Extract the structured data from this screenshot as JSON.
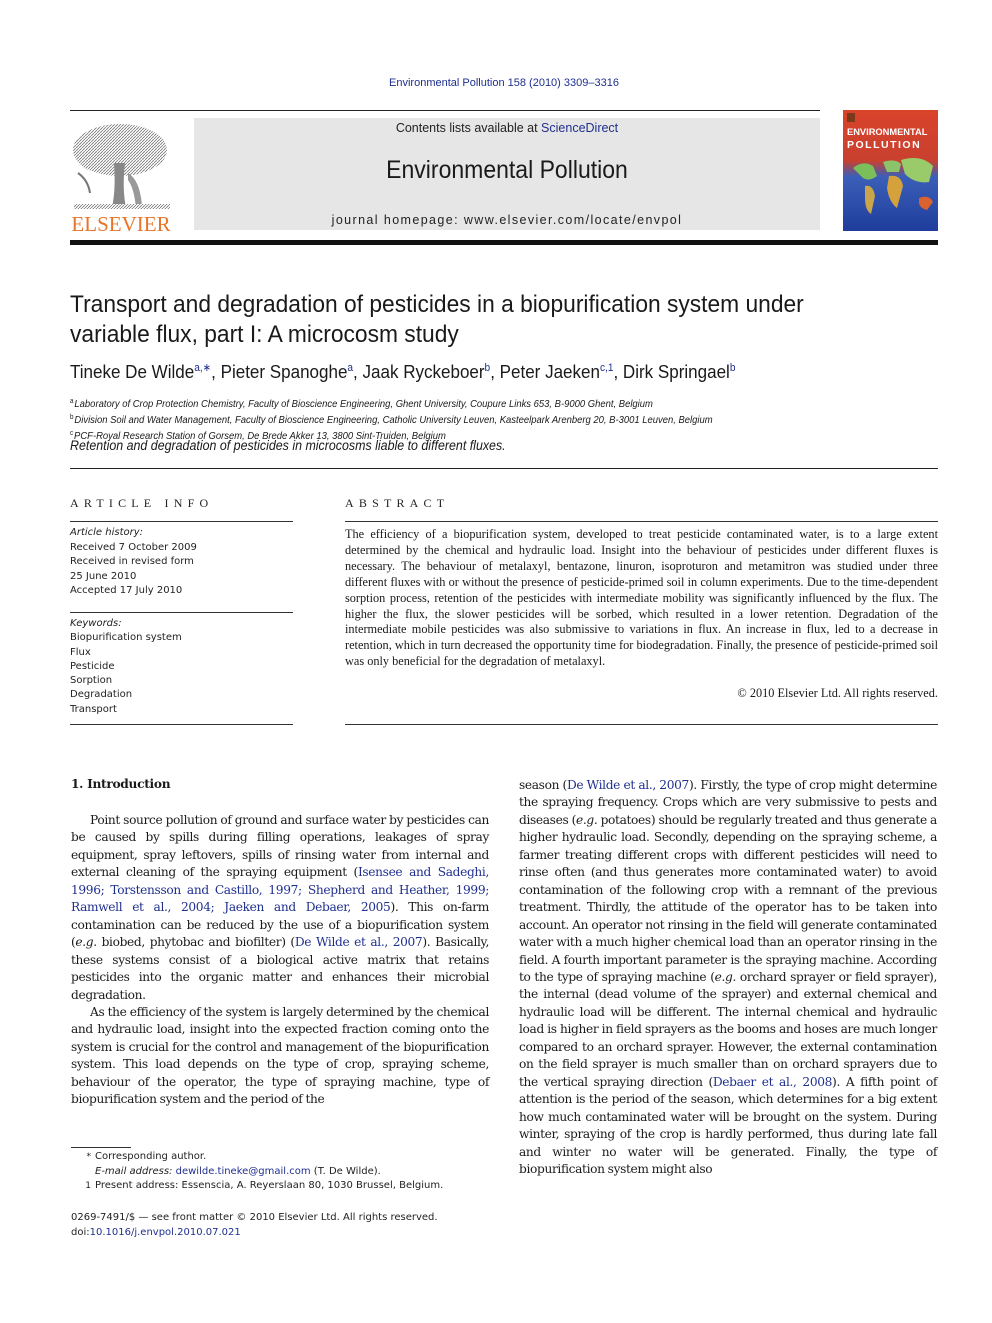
{
  "header": {
    "journal_ref": "Environmental Pollution 158 (2010) 3309–3316",
    "contents_prefix": "Contents lists available at ",
    "contents_link": "ScienceDirect",
    "journal_title": "Environmental Pollution",
    "homepage": "journal homepage: www.elsevier.com/locate/envpol",
    "publisher_logo": "ELSEVIER",
    "cover_title_1": "ENVIRONMENTAL",
    "cover_title_2": "POLLUTION",
    "colors": {
      "link": "#1f2f8f",
      "elsevier_orange": "#e8742a",
      "header_gray": "#e6e6e6"
    }
  },
  "article": {
    "title_line_1": "Transport and degradation of pesticides in a biopurification system under",
    "title_line_2": "variable flux, part I: A microcosm study",
    "authors": [
      {
        "name": "Tineke De Wilde",
        "sup": "a,∗",
        "sep": ", "
      },
      {
        "name": "Pieter Spanoghe",
        "sup": "a",
        "sep": ", "
      },
      {
        "name": "Jaak Ryckeboer",
        "sup": "b",
        "sep": ", "
      },
      {
        "name": "Peter Jaeken",
        "sup": "c,1",
        "sep": ", "
      },
      {
        "name": "Dirk Springael",
        "sup": "b",
        "sep": ""
      }
    ],
    "affiliations": [
      {
        "mark": "a",
        "text": "Laboratory of Crop Protection Chemistry, Faculty of Bioscience Engineering, Ghent University, Coupure Links 653, B-9000 Ghent, Belgium"
      },
      {
        "mark": "b",
        "text": "Division Soil and Water Management, Faculty of Bioscience Engineering, Catholic University Leuven, Kasteelpark Arenberg 20, B-3001 Leuven, Belgium"
      },
      {
        "mark": "c",
        "text": "PCF-Royal Research Station of Gorsem, De Brede Akker 13, 3800 Sint-Truiden, Belgium"
      }
    ],
    "highlight": "Retention and degradation of pesticides in microcosms liable to different fluxes."
  },
  "article_info": {
    "heading": "ARTICLE INFO",
    "history_label": "Article history:",
    "history": [
      "Received 7 October 2009",
      "Received in revised form",
      "25 June 2010",
      "Accepted 17 July 2010"
    ],
    "keywords_label": "Keywords:",
    "keywords": [
      "Biopurification system",
      "Flux",
      "Pesticide",
      "Sorption",
      "Degradation",
      "Transport"
    ]
  },
  "abstract": {
    "heading": "ABSTRACT",
    "text": "The efficiency of a biopurification system, developed to treat pesticide contaminated water, is to a large extent determined by the chemical and hydraulic load. Insight into the behaviour of pesticides under different fluxes is necessary. The behaviour of metalaxyl, bentazone, linuron, isoproturon and metamitron was studied under three different fluxes with or without the presence of pesticide-primed soil in column experiments. Due to the time-dependent sorption process, retention of the pesticides with intermediate mobility was significantly influenced by the flux. The higher the flux, the slower pesticides will be sorbed, which resulted in a lower retention. Degradation of the intermediate mobile pesticides was also submissive to variations in flux. An increase in flux, led to a decrease in retention, which in turn decreased the opportunity time for biodegradation. Finally, the presence of pesticide-primed soil was only beneficial for the degradation of metalaxyl.",
    "copyright": "© 2010 Elsevier Ltd. All rights reserved."
  },
  "body": {
    "section_heading": "1.  Introduction",
    "p1": {
      "t1": "Point source pollution of ground and surface water by pesticides can be caused by spills during filling operations, leakages of spray equipment, spray leftovers, spills of rinsing water from internal and external cleaning of the spraying equipment (",
      "c1": "Isensee and Sadeghi, 1996; Torstensson and Castillo, 1997; Shepherd and Heather, 1999; Ramwell et al., 2004; Jaeken and Debaer, 2005",
      "t2": "). This on-farm contamination can be reduced by the use of a biopurification system (",
      "eg": "e.g.",
      "t3": " biobed, phytobac and biofilter) (",
      "c2": "De Wilde et al., 2007",
      "t4": "). Basically, these systems consist of a biological active matrix that retains pesticides into the organic matter and enhances their microbial degradation."
    },
    "p2": {
      "t1": "As the efficiency of the system is largely determined by the chemical and hydraulic load, insight into the expected fraction coming onto the system is crucial for the control and management of the biopurification system. This load depends on the type of crop, spraying scheme, behaviour of the operator, the type of spraying machine, type of biopurification system and the period of the"
    },
    "right": {
      "t1": "season (",
      "c1": "De Wilde et al., 2007",
      "t2": "). Firstly, the type of crop might determine the spraying frequency. Crops which are very submissive to pests and diseases (",
      "eg1": "e.g.",
      "t3": " potatoes) should be regularly treated and thus generate a higher hydraulic load. Secondly, depending on the spraying scheme, a farmer treating different crops with different pesticides will need to rinse often (and thus generates more contaminated water) to avoid contamination of the following crop with a remnant of the previous treatment. Thirdly, the attitude of the operator has to be taken into account. An operator not rinsing in the field will generate contaminated water with a much higher chemical load than an operator rinsing in the field. A fourth important parameter is the spraying machine. According to the type of spraying machine (",
      "eg2": "e.g.",
      "t4": " orchard sprayer or field sprayer), the internal (dead volume of the sprayer) and external chemical and hydraulic load will be different. The internal chemical and hydraulic load is higher in field sprayers as the booms and hoses are much longer compared to an orchard sprayer. However, the external contamination on the field sprayer is much smaller than on orchard sprayers due to the vertical spraying direction (",
      "c2": "Debaer et al., 2008",
      "t5": "). A fifth point of attention is the period of the season, which determines for a big extent how much contaminated water will be brought on the system. During winter, spraying of the crop is hardly performed, thus during late fall and winter no water will be generated. Finally, the type of biopurification system might also"
    }
  },
  "footnotes": {
    "star_mark": "*",
    "star_text": "Corresponding author.",
    "email_label": "E-mail address:",
    "email": "dewilde.tineke@gmail.com",
    "email_suffix": " (T. De Wilde).",
    "one_mark": "1",
    "one_text": "Present address: Essenscia, A. Reyerslaan 80, 1030 Brussel, Belgium."
  },
  "footer": {
    "issn": "0269-7491/$ — see front matter © 2010 Elsevier Ltd. All rights reserved.",
    "doi_prefix": "doi:",
    "doi": "10.1016/j.envpol.2010.07.021"
  }
}
